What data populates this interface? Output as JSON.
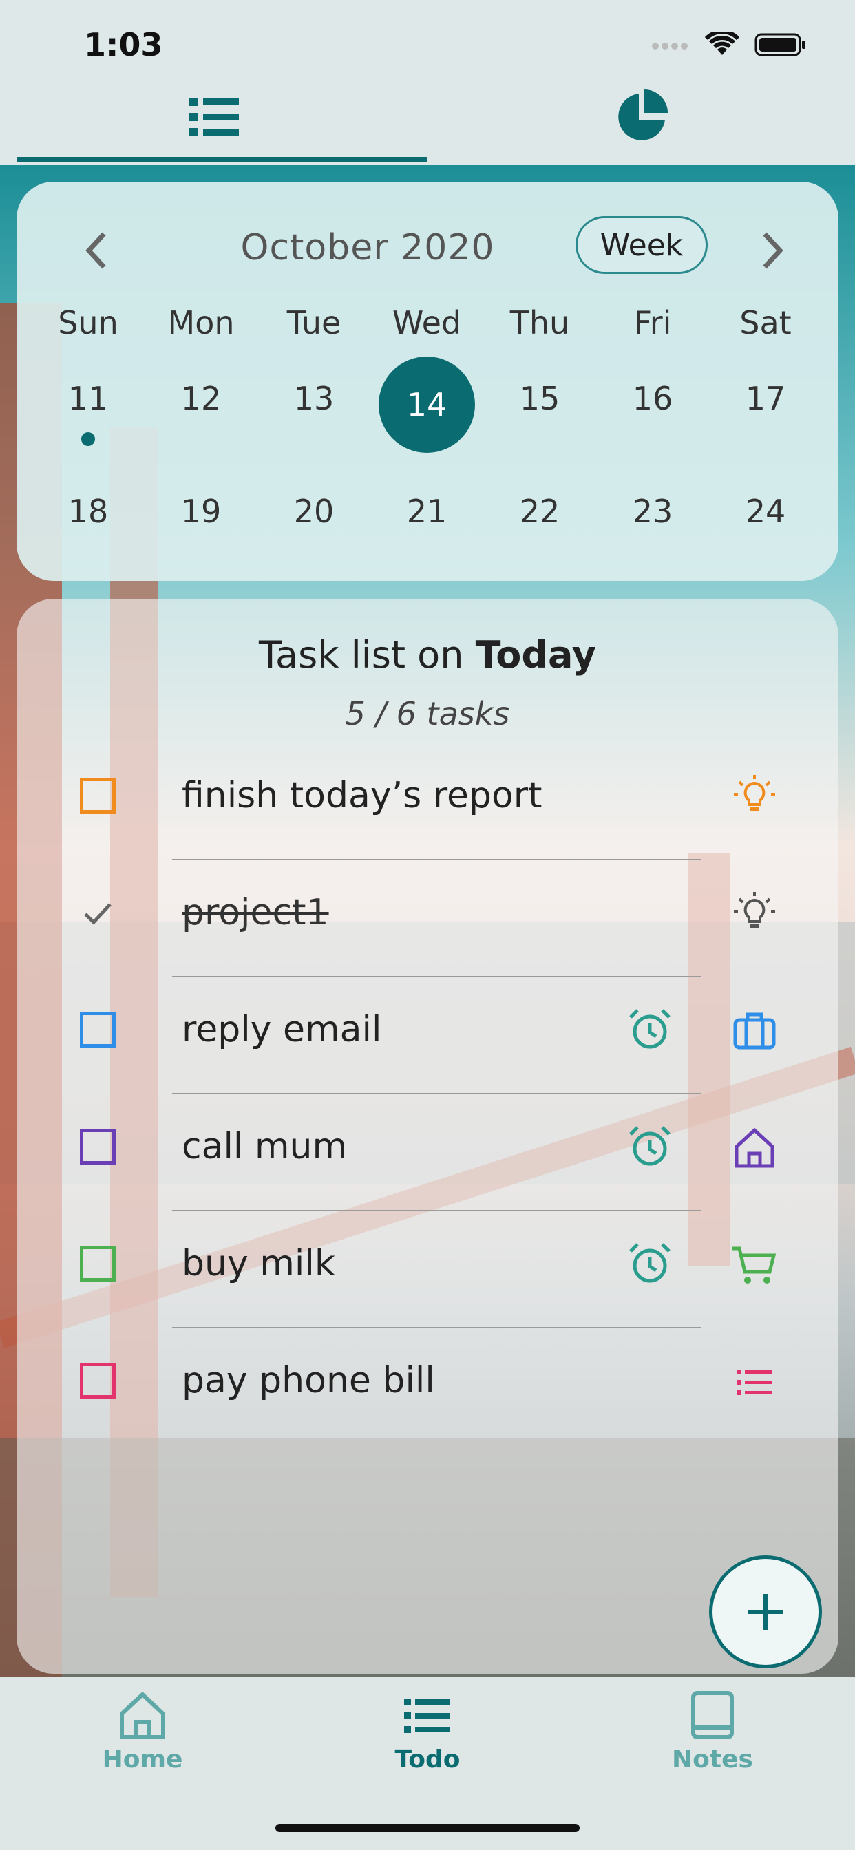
{
  "status_bar": {
    "time": "1:03"
  },
  "top_tabs": [
    {
      "icon": "list-icon",
      "active": true
    },
    {
      "icon": "pie-chart-icon",
      "active": false
    }
  ],
  "calendar": {
    "month_label": "October 2020",
    "view_button": "Week",
    "weekdays": [
      "Sun",
      "Mon",
      "Tue",
      "Wed",
      "Thu",
      "Fri",
      "Sat"
    ],
    "week1": [
      "11",
      "12",
      "13",
      "14",
      "15",
      "16",
      "17"
    ],
    "week2": [
      "18",
      "19",
      "20",
      "21",
      "22",
      "23",
      "24"
    ],
    "selected_day": "14",
    "event_day": "11"
  },
  "tasks": {
    "title_prefix": "Task list on ",
    "title_day": "Today",
    "count_label": "5 / 6 tasks",
    "items": [
      {
        "label": "finish today’s report",
        "done": false,
        "color": "#f08c1e",
        "alarm": false,
        "category_icon": "lightbulb-icon"
      },
      {
        "label": "project1",
        "done": true,
        "color": "#555555",
        "alarm": false,
        "category_icon": "lightbulb-icon"
      },
      {
        "label": "reply email",
        "done": false,
        "color": "#2f8ee8",
        "alarm": true,
        "category_icon": "briefcase-icon"
      },
      {
        "label": "call mum",
        "done": false,
        "color": "#6a3fb5",
        "alarm": true,
        "category_icon": "house-icon"
      },
      {
        "label": "buy milk",
        "done": false,
        "color": "#4caf50",
        "alarm": true,
        "category_icon": "cart-icon"
      },
      {
        "label": "pay phone bill",
        "done": false,
        "color": "#e3336c",
        "alarm": false,
        "category_icon": "list-icon"
      }
    ]
  },
  "fab": {
    "icon": "plus-icon"
  },
  "bottom_nav": [
    {
      "label": "Home",
      "icon": "home-icon",
      "active": false
    },
    {
      "label": "Todo",
      "icon": "list-icon",
      "active": true
    },
    {
      "label": "Notes",
      "icon": "book-icon",
      "active": false
    }
  ],
  "colors": {
    "accent": "#0a6b70",
    "alarm": "#2a9d8f",
    "inactive_nav": "#5fa8a8"
  }
}
